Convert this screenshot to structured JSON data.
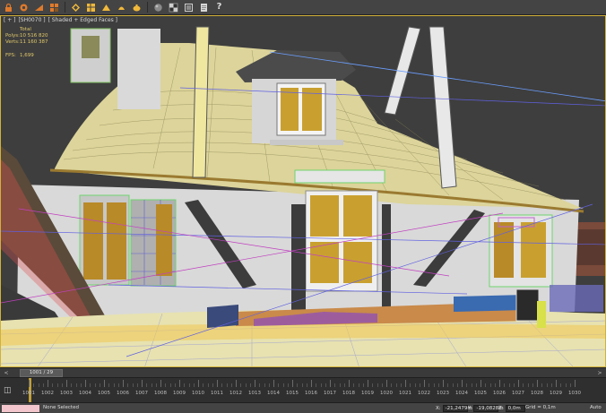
{
  "app": {
    "toolbar_icons": [
      "lock-icon",
      "rotate-icon",
      "slice-icon",
      "selection-icon",
      "diamond-icon",
      "puzzle-icon",
      "render-icon",
      "render-scene-icon",
      "teapot-icon",
      "sphere-gray-icon",
      "material-icon",
      "render-frame-icon",
      "document-icon",
      "help-icon"
    ],
    "help_label": "?"
  },
  "viewport": {
    "label_parts": [
      "[ + ]",
      "[SH0070 ]",
      "[ Shaded + Edged Faces ]"
    ],
    "stats": {
      "header": "Total",
      "polys_label": "Polys:",
      "polys_value": "10 516 820",
      "verts_label": "Verts:",
      "verts_value": "11 160 387",
      "fps_label": "FPS:",
      "fps_value": "1,699"
    },
    "colors": {
      "frame": "#d2b13a",
      "background": "#3d3d3d"
    }
  },
  "timeslider": {
    "current": "1001 / 29",
    "prev": "<",
    "next": ">"
  },
  "trackbar": {
    "ticks": [
      "1001",
      "1002",
      "1003",
      "1004",
      "1005",
      "1006",
      "1007",
      "1008",
      "1009",
      "1010",
      "1011",
      "1012",
      "1013",
      "1014",
      "1015",
      "1016",
      "1017",
      "1018",
      "1019",
      "1020",
      "1021",
      "1022",
      "1023",
      "1024",
      "1025",
      "1026",
      "1027",
      "1028",
      "1029",
      "1030"
    ]
  },
  "statusbar": {
    "status": "None Selected",
    "x_label": "X:",
    "x_value": "-21,2479m",
    "y_label": "Y:",
    "y_value": "-19,0828m",
    "z_label": "Z:",
    "z_value": "0,0m",
    "grid": "Grid = 0,1m",
    "auto": "Auto"
  }
}
